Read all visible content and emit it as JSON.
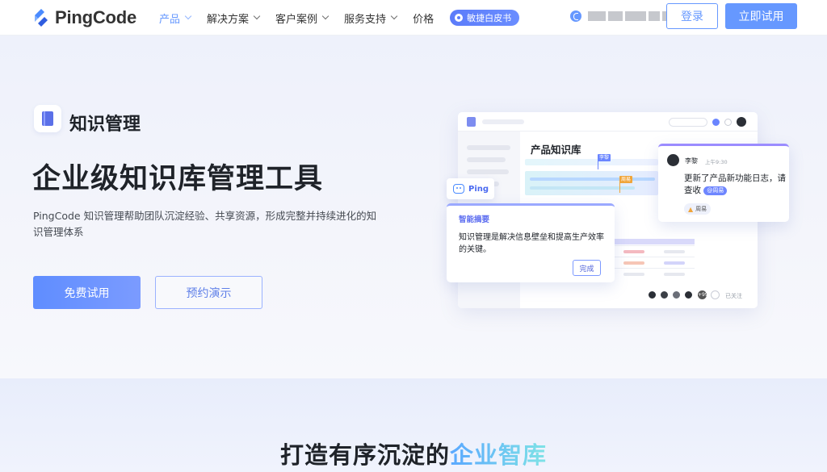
{
  "brand": {
    "name": "PingCode",
    "accent": "#6698ff"
  },
  "nav": {
    "items": [
      {
        "label": "产品",
        "dropdown": true,
        "active": true
      },
      {
        "label": "解决方案",
        "dropdown": true,
        "active": false
      },
      {
        "label": "客户案例",
        "dropdown": true,
        "active": false
      },
      {
        "label": "服务支持",
        "dropdown": true,
        "active": false
      },
      {
        "label": "价格",
        "dropdown": false,
        "active": false
      }
    ],
    "pill_label": "敏捷白皮书"
  },
  "header": {
    "login_label": "登录",
    "trial_label": "立即试用"
  },
  "hero": {
    "badge_label": "知识管理",
    "title": "企业级知识库管理工具",
    "description": "PingCode 知识管理帮助团队沉淀经验、共享资源，形成完整并持续进化的知识管理体系",
    "primary_button": "免费试用",
    "secondary_button": "预约演示"
  },
  "illustration": {
    "kb_title": "产品知识库",
    "flag_a": "李黎",
    "flag_b": "周易",
    "ping_label": "Ping",
    "summary": {
      "label": "智能摘要",
      "text": "知识管理是解决信息壁垒和提高生产效率的关键。",
      "done_label": "完成"
    },
    "comment": {
      "name": "李黎",
      "time": "上午9:30",
      "text": "更新了产品新功能日志，请查收",
      "mention": "@周易",
      "reply": "周易"
    },
    "avatar_count": "+99",
    "follow_text": "已关注"
  },
  "section": {
    "title_plain": "打造有序沉淀的",
    "title_highlight": "企业智库"
  }
}
